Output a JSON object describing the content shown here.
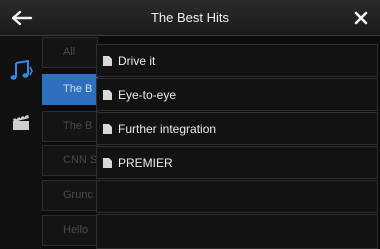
{
  "window": {
    "title": "The Best Hits"
  },
  "sidebar": {
    "icons": [
      "music-icon",
      "video-icon"
    ]
  },
  "left_list": {
    "items": [
      "All",
      "The B",
      "The B",
      "CNN S",
      "Grunc",
      "Hello"
    ]
  },
  "right_list": {
    "items": [
      "Drive it",
      "Eye-to-eye",
      "Further integration",
      "PREMIER"
    ]
  },
  "colors": {
    "accent": "#2e6fbe",
    "music_icon": "#3a89e6",
    "background": "#0c0c0c"
  }
}
